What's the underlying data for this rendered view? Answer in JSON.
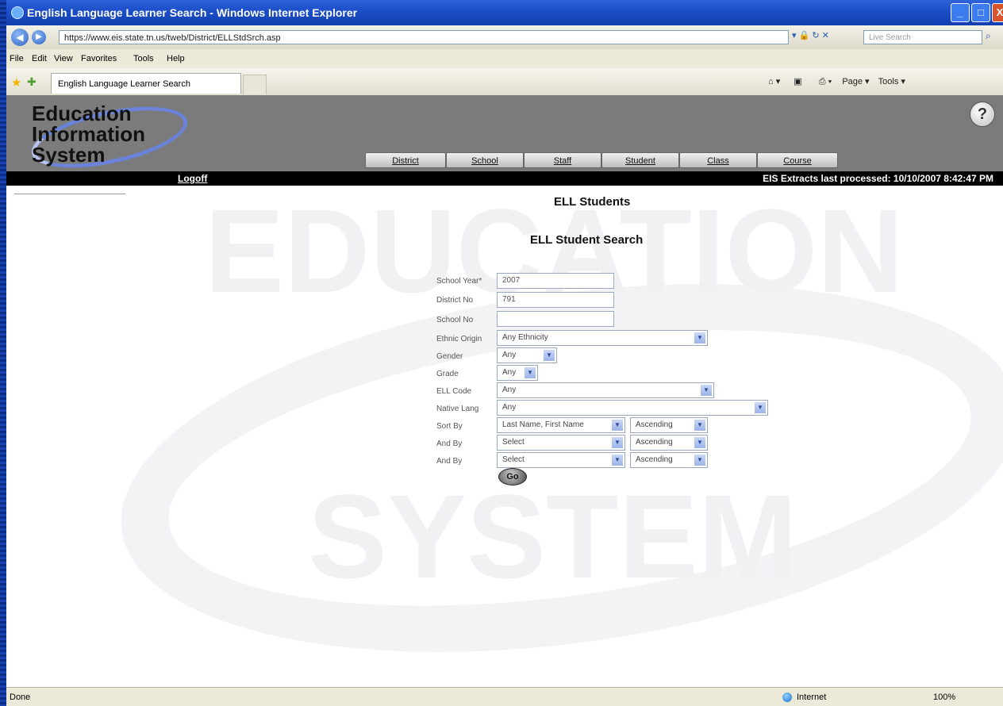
{
  "window": {
    "title": "English Language Learner Search - Windows Internet Explorer",
    "minimize": "_",
    "maximize": "□",
    "close": "X"
  },
  "address": {
    "url": "https://www.eis.state.tn.us/tweb/District/ELLStdSrch.asp",
    "search_placeholder": "Live Search",
    "icons": "▾ 🔒 ↻ ✕"
  },
  "menu": {
    "file": "File",
    "edit": "Edit",
    "view": "View",
    "favorites": "Favorites",
    "tools": "Tools",
    "help": "Help"
  },
  "tab": {
    "label": "English Language Learner Search"
  },
  "commandbar": {
    "page": "Page ▾",
    "tools": "Tools ▾"
  },
  "header": {
    "logo_lines": [
      "Education",
      "Information",
      "System"
    ],
    "help": "?",
    "nav": [
      "District",
      "School",
      "Staff",
      "Student",
      "Class",
      "Course"
    ],
    "logoff": "Logoff",
    "extract": "EIS Extracts last processed: 10/10/2007 8:42:47 PM"
  },
  "page": {
    "title": "ELL Students",
    "subtitle": "ELL Student Search"
  },
  "form": {
    "school_year_label": "School Year*",
    "school_year_value": "2007",
    "district_label": "District No",
    "district_value": "791",
    "school_label": "School No",
    "school_value": "",
    "ethnic_label": "Ethnic Origin",
    "ethnic_value": "Any Ethnicity",
    "gender_label": "Gender",
    "gender_value": "Any",
    "grade_label": "Grade",
    "grade_value": "Any",
    "ell_label": "ELL Code",
    "ell_value": "Any",
    "lang_label": "Native Lang",
    "lang_value": "Any",
    "sort1_label": "Sort By",
    "sort1_value": "Last Name, First Name",
    "sort1_order": "Ascending",
    "sort2_label": "And By",
    "sort2_value": "Select",
    "sort2_order": "Ascending",
    "sort3_label": "And By",
    "sort3_value": "Select",
    "sort3_order": "Ascending",
    "go": "Go"
  },
  "status": {
    "text": "Done",
    "zone": "Internet",
    "zoom": "100%"
  }
}
